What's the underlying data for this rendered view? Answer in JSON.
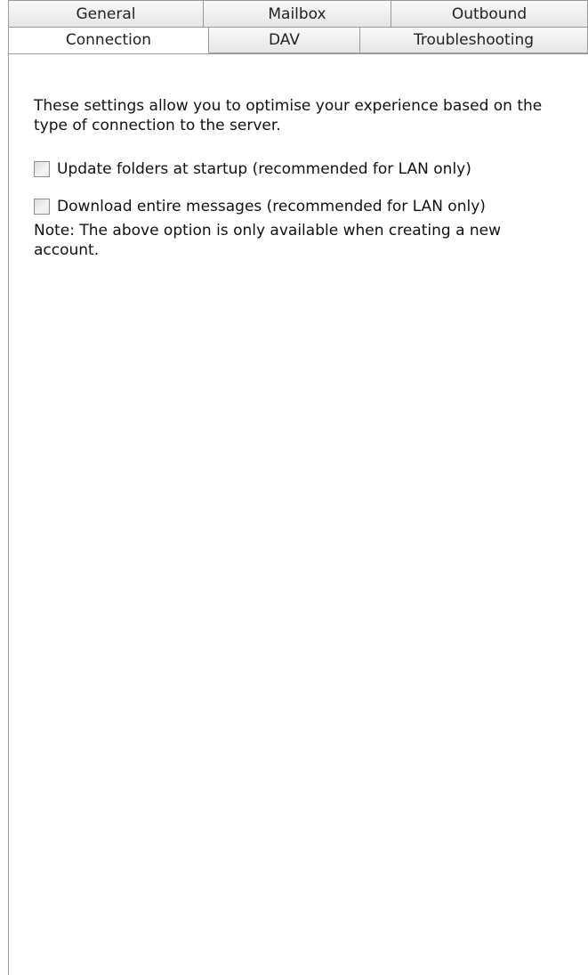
{
  "tabs": {
    "back_row": [
      "General",
      "Mailbox",
      "Outbound"
    ],
    "front_row": [
      "Connection",
      "DAV",
      "Troubleshooting"
    ],
    "active": "Connection"
  },
  "panel": {
    "intro": "These settings allow you to optimise your experience based on the type of connection to the server.",
    "options": [
      {
        "label": "Update folders at startup (recommended for LAN only)",
        "checked": false
      },
      {
        "label": "Download entire messages (recommended for LAN only)",
        "checked": false
      }
    ],
    "note": "Note: The above option is only available when creating a new account."
  }
}
